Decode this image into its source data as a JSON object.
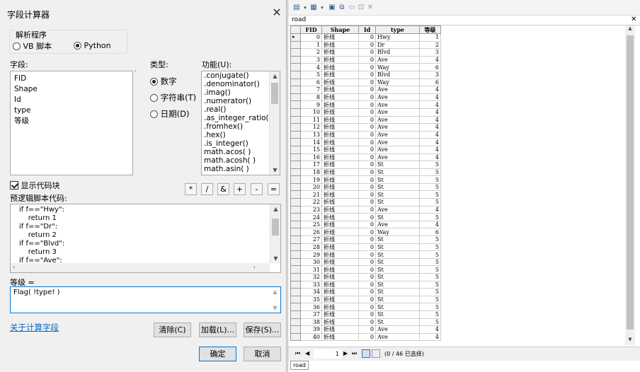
{
  "dialog": {
    "title": "字段计算器",
    "parser_label": "解析程序",
    "parser_vb": "VB 脚本",
    "parser_python": "Python",
    "fields_label": "字段:",
    "fields": [
      "FID",
      "Shape",
      "Id",
      "type",
      "等级"
    ],
    "type_label": "类型:",
    "type_number": "数字",
    "type_string": "字符串(T)",
    "type_date": "日期(D)",
    "functions_label": "功能(U):",
    "functions": [
      ".conjugate()",
      ".denominator()",
      ".imag()",
      ".numerator()",
      ".real()",
      ".as_integer_ratio()",
      ".fromhex()",
      ".hex()",
      ".is_integer()",
      "math.acos( )",
      "math.acosh( )",
      "math.asin( )"
    ],
    "show_codeblock": "显示代码块",
    "operators": [
      "*",
      "/",
      "&",
      "+",
      "-",
      "="
    ],
    "prelogic_label": "预逻辑脚本代码:",
    "code_lines": [
      "if f==\"Hwy\":",
      "    return 1",
      "if f==\"Dr\":",
      "    return 2",
      "if f==\"Blvd\":",
      "    return 3",
      "if f==\"Ave\":"
    ],
    "expr_label": "等级 =",
    "expression": "Flag( !type! )",
    "about_link": "关于计算字段",
    "clear_btn": "清除(C)",
    "load_btn": "加载(L)...",
    "save_btn": "保存(S)...",
    "ok_btn": "确定",
    "cancel_btn": "取消"
  },
  "table": {
    "title": "road",
    "tab_label": "road",
    "columns": [
      "FID",
      "Shape",
      "Id",
      "type",
      "等级"
    ],
    "rows": [
      [
        "0",
        "折线",
        "0",
        "Hwy",
        "1"
      ],
      [
        "1",
        "折线",
        "0",
        "Dr",
        "2"
      ],
      [
        "2",
        "折线",
        "0",
        "Blvd",
        "3"
      ],
      [
        "3",
        "折线",
        "0",
        "Ave",
        "4"
      ],
      [
        "4",
        "折线",
        "0",
        "Way",
        "6"
      ],
      [
        "5",
        "折线",
        "0",
        "Blvd",
        "3"
      ],
      [
        "6",
        "折线",
        "0",
        "Way",
        "6"
      ],
      [
        "7",
        "折线",
        "0",
        "Ave",
        "4"
      ],
      [
        "8",
        "折线",
        "0",
        "Ave",
        "4"
      ],
      [
        "9",
        "折线",
        "0",
        "Ave",
        "4"
      ],
      [
        "10",
        "折线",
        "0",
        "Ave",
        "4"
      ],
      [
        "11",
        "折线",
        "0",
        "Ave",
        "4"
      ],
      [
        "12",
        "折线",
        "0",
        "Ave",
        "4"
      ],
      [
        "13",
        "折线",
        "0",
        "Ave",
        "4"
      ],
      [
        "14",
        "折线",
        "0",
        "Ave",
        "4"
      ],
      [
        "15",
        "折线",
        "0",
        "Ave",
        "4"
      ],
      [
        "16",
        "折线",
        "0",
        "Ave",
        "4"
      ],
      [
        "17",
        "折线",
        "0",
        "St",
        "5"
      ],
      [
        "18",
        "折线",
        "0",
        "St",
        "5"
      ],
      [
        "19",
        "折线",
        "0",
        "St",
        "5"
      ],
      [
        "20",
        "折线",
        "0",
        "St",
        "5"
      ],
      [
        "21",
        "折线",
        "0",
        "St",
        "5"
      ],
      [
        "22",
        "折线",
        "0",
        "St",
        "5"
      ],
      [
        "23",
        "折线",
        "0",
        "Ave",
        "4"
      ],
      [
        "24",
        "折线",
        "0",
        "St",
        "5"
      ],
      [
        "25",
        "折线",
        "0",
        "Ave",
        "4"
      ],
      [
        "26",
        "折线",
        "0",
        "Way",
        "6"
      ],
      [
        "27",
        "折线",
        "0",
        "St",
        "5"
      ],
      [
        "28",
        "折线",
        "0",
        "St",
        "5"
      ],
      [
        "29",
        "折线",
        "0",
        "St",
        "5"
      ],
      [
        "30",
        "折线",
        "0",
        "St",
        "5"
      ],
      [
        "31",
        "折线",
        "0",
        "St",
        "5"
      ],
      [
        "32",
        "折线",
        "0",
        "St",
        "5"
      ],
      [
        "33",
        "折线",
        "0",
        "St",
        "5"
      ],
      [
        "34",
        "折线",
        "0",
        "St",
        "5"
      ],
      [
        "35",
        "折线",
        "0",
        "St",
        "5"
      ],
      [
        "36",
        "折线",
        "0",
        "St",
        "5"
      ],
      [
        "37",
        "折线",
        "0",
        "St",
        "5"
      ],
      [
        "38",
        "折线",
        "0",
        "St",
        "5"
      ],
      [
        "39",
        "折线",
        "0",
        "Ave",
        "4"
      ],
      [
        "40",
        "折线",
        "0",
        "Ave",
        "4"
      ]
    ],
    "record_index": "1",
    "record_status": "(0 / 46 已选择)"
  }
}
